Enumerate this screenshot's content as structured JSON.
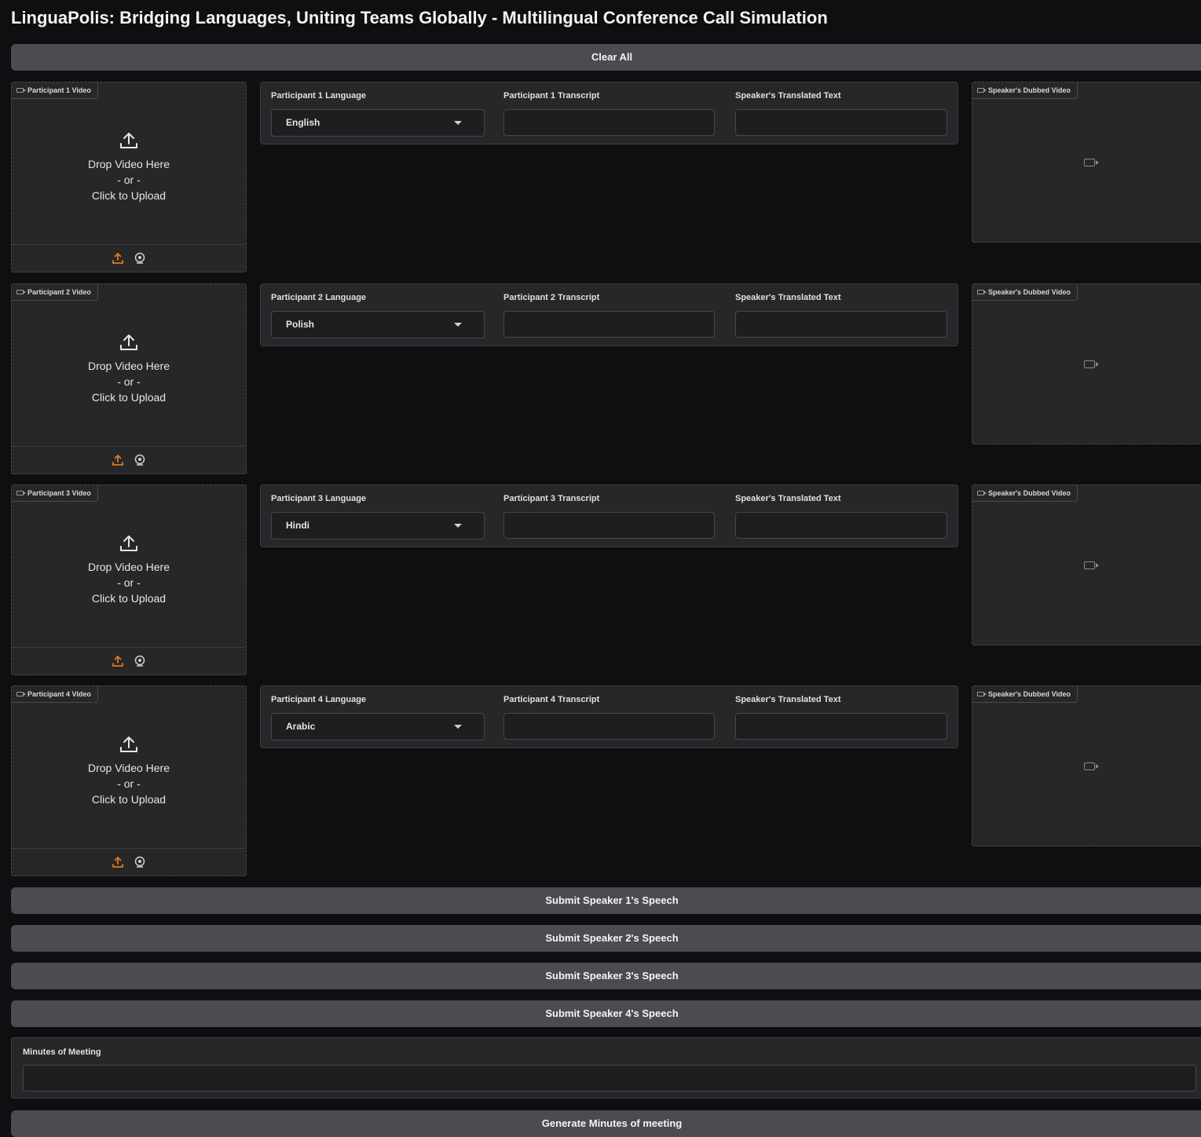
{
  "app": {
    "title": "LinguaPolis: Bridging Languages, Uniting Teams Globally - Multilingual Conference Call Simulation"
  },
  "toolbar": {
    "clear_label": "Clear All"
  },
  "participants": [
    {
      "video_label": "Participant 1 Video",
      "drop_line1": "Drop Video Here",
      "drop_line2": "- or -",
      "drop_line3": "Click to Upload",
      "language_label": "Participant 1 Language",
      "language_value": "English",
      "transcript_label": "Participant 1 Transcript",
      "transcript_value": "",
      "translated_label": "Speaker's Translated Text",
      "translated_value": "",
      "dubbed_label": "Speaker's Dubbed Video"
    },
    {
      "video_label": "Participant 2 Video",
      "drop_line1": "Drop Video Here",
      "drop_line2": "- or -",
      "drop_line3": "Click to Upload",
      "language_label": "Participant 2 Language",
      "language_value": "Polish",
      "transcript_label": "Participant 2 Transcript",
      "transcript_value": "",
      "translated_label": "Speaker's Translated Text",
      "translated_value": "",
      "dubbed_label": "Speaker's Dubbed Video"
    },
    {
      "video_label": "Participant 3 Video",
      "drop_line1": "Drop Video Here",
      "drop_line2": "- or -",
      "drop_line3": "Click to Upload",
      "language_label": "Participant 3 Language",
      "language_value": "Hindi",
      "transcript_label": "Participant 3 Transcript",
      "transcript_value": "",
      "translated_label": "Speaker's Translated Text",
      "translated_value": "",
      "dubbed_label": "Speaker's Dubbed Video"
    },
    {
      "video_label": "Participant 4 Video",
      "drop_line1": "Drop Video Here",
      "drop_line2": "- or -",
      "drop_line3": "Click to Upload",
      "language_label": "Participant 4 Language",
      "language_value": "Arabic",
      "transcript_label": "Participant 4 Transcript",
      "transcript_value": "",
      "translated_label": "Speaker's Translated Text",
      "translated_value": "",
      "dubbed_label": "Speaker's Dubbed Video"
    }
  ],
  "submit_buttons": [
    "Submit Speaker 1's Speech",
    "Submit Speaker 2's Speech",
    "Submit Speaker 3's Speech",
    "Submit Speaker 4's Speech"
  ],
  "minutes": {
    "label": "Minutes of Meeting",
    "value": "",
    "generate_label": "Generate Minutes of meeting"
  },
  "icons": {
    "upload": "upload-arrow-icon",
    "upload_source": "upload-source-icon",
    "webcam": "webcam-icon",
    "video_camera": "video-camera-icon",
    "dropdown": "chevron-down-icon"
  },
  "colors": {
    "background": "#0f0f11",
    "panel": "#27272a",
    "button": "#4b4b52",
    "accent_orange": "#e07a1f"
  }
}
